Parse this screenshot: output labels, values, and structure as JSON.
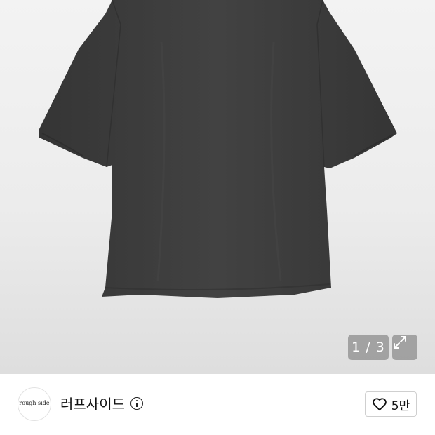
{
  "gallery": {
    "counter": "1 / 3",
    "expand_icon": "expand-icon",
    "product_color": "#3c3c3c"
  },
  "brand": {
    "logo_text": "rough side",
    "name": "러프사이드",
    "info_icon": "info-icon"
  },
  "like": {
    "icon": "heart-icon",
    "count": "5만"
  }
}
